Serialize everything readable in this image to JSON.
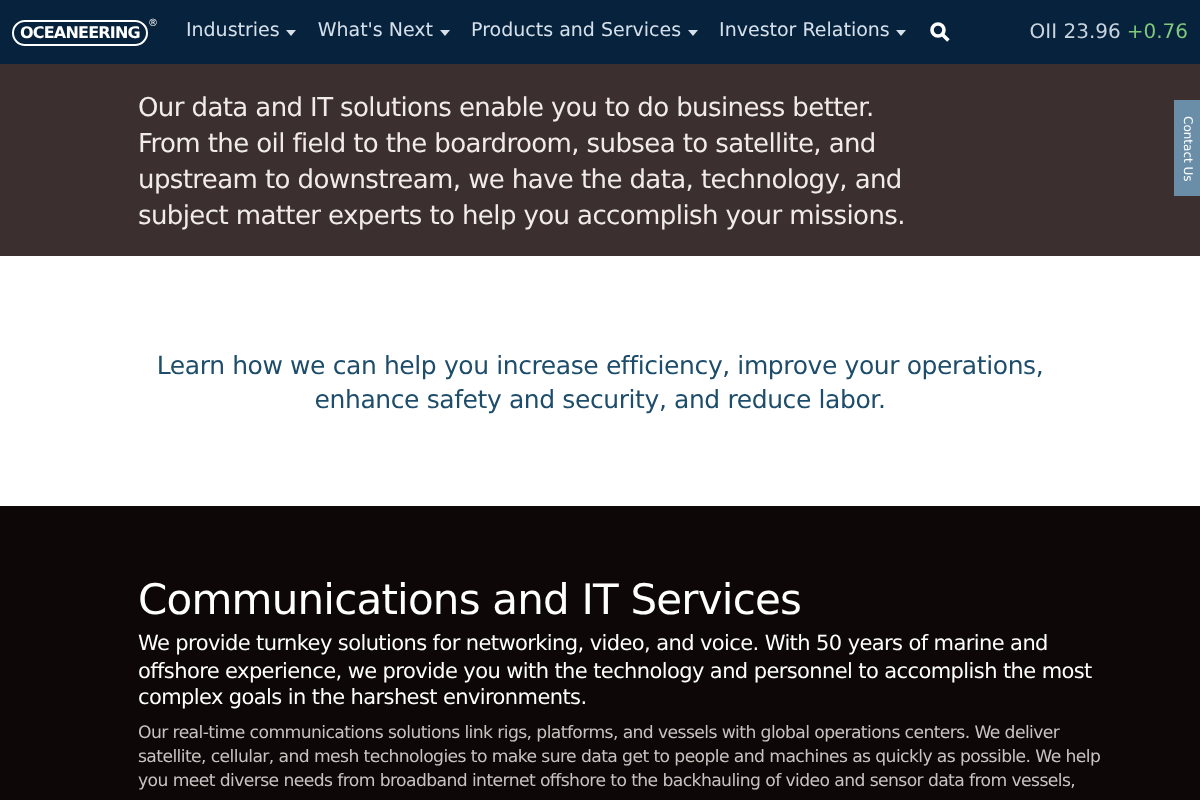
{
  "header": {
    "logo": "OCEANEERING",
    "logo_mark": "®",
    "nav": [
      {
        "label": "Industries"
      },
      {
        "label": "What's Next"
      },
      {
        "label": "Products and Services"
      },
      {
        "label": "Investor Relations"
      }
    ],
    "stock": {
      "ticker": "OII 23.96",
      "change": "+0.76"
    }
  },
  "hero": {
    "text": "Our data and IT solutions enable you to do business better. From the oil field to the boardroom, subsea to satellite, and upstream to downstream, we have the data, technology, and subject matter experts to help you accomplish your missions."
  },
  "contact_tab": "Contact Us",
  "intro": {
    "text": "Learn how we can help you increase efficiency, improve your operations, enhance safety and security, and reduce labor."
  },
  "section": {
    "title": "Communications and IT Services",
    "lead": "We provide turnkey solutions for networking, video, and voice. With 50 years of marine and offshore experience, we provide you with the technology and personnel to accomplish the most complex goals in the harshest environments.",
    "body": "Our real-time communications solutions link rigs, platforms, and vessels with global operations centers. We deliver satellite, cellular, and mesh technologies to make sure data get to people and machines as quickly as possible. We help you meet diverse needs from broadband internet offshore to the backhauling of video and sensor data from vessels,"
  }
}
